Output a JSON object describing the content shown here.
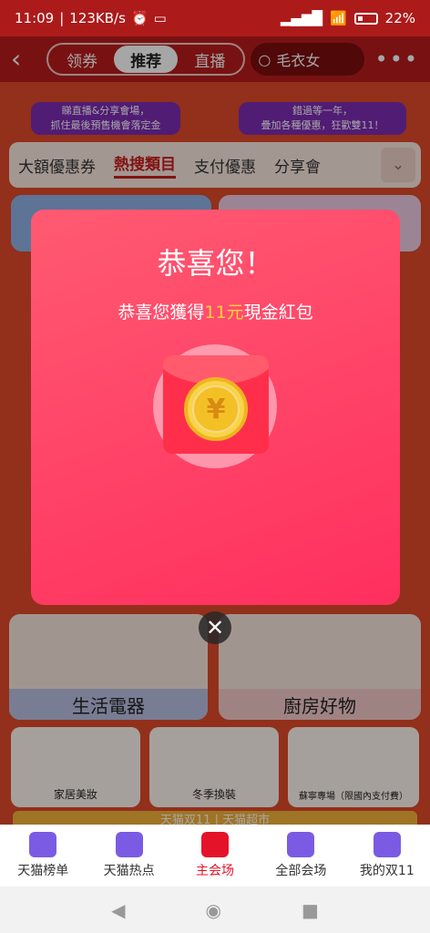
{
  "status_bar": {
    "time": "11:09",
    "speed": "123KB/s",
    "battery": "22%"
  },
  "top_nav": {
    "tabs": [
      "领券",
      "推荐",
      "直播"
    ],
    "active_tab": "推荐",
    "search_placeholder": "毛衣女"
  },
  "page": {
    "promo_tags": [
      "睇直播&分享會場，\n抓住最後預售機會落定金",
      "錯過等一年，\n疊加各種優惠，狂歡雙11！"
    ],
    "categories": [
      "大額優惠券",
      "熱搜類目",
      "支付優惠",
      "分享會"
    ],
    "sections": [
      "生活電器",
      "廚房好物"
    ],
    "products": [
      "家居美妝",
      "冬季換裝",
      "蘇寧專場（限國內支付費）"
    ],
    "banner": "天猫双11 | 天猫超市"
  },
  "modal": {
    "title": "恭喜您！",
    "subtitle_before": "恭喜您獲得",
    "amount": "11元",
    "subtitle_after": "現金紅包",
    "coin_symbol": "¥"
  },
  "bottom_tabs": [
    {
      "label": "天猫榜单",
      "icon": "thumbs-up-icon"
    },
    {
      "label": "天猫热点",
      "icon": "fire-icon"
    },
    {
      "label": "主会场",
      "icon": "tmall-cat-icon"
    },
    {
      "label": "全部会场",
      "icon": "grid-icon"
    },
    {
      "label": "我的双11",
      "icon": "user-icon"
    }
  ],
  "active_bottom_tab": "主会场"
}
